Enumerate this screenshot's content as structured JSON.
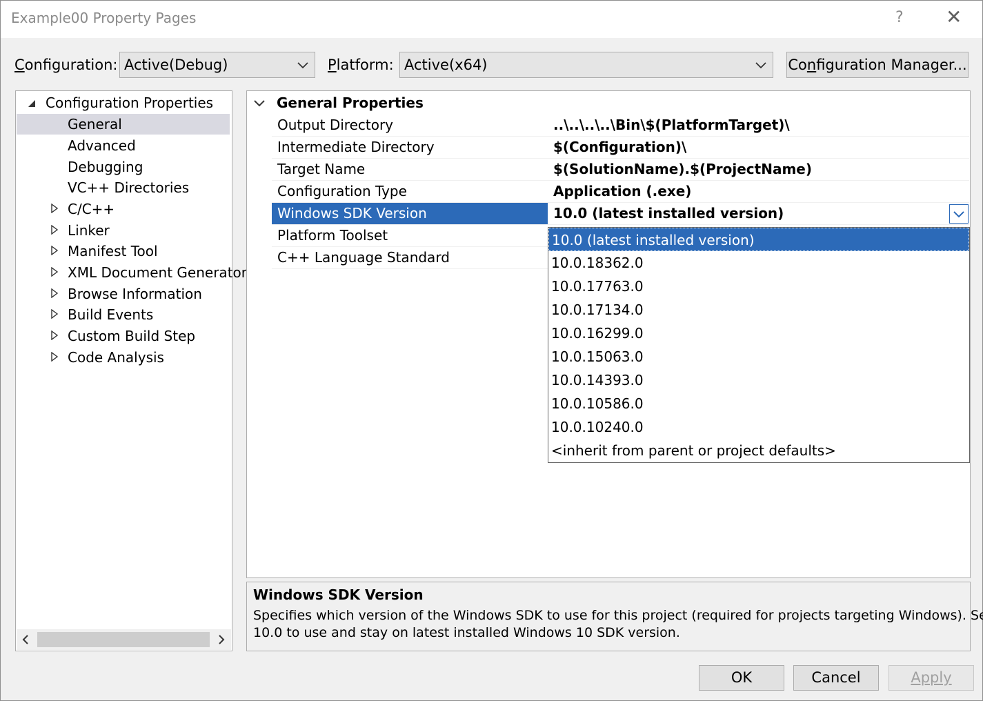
{
  "window": {
    "title": "Example00 Property Pages",
    "help": "?",
    "close": "✕"
  },
  "toolbar": {
    "configuration_label": "Configuration:",
    "configuration_label_key": "C",
    "configuration_label_rest": "onfiguration:",
    "configuration_value": "Active(Debug)",
    "platform_label_key": "P",
    "platform_label_rest": "latform:",
    "platform_value": "Active(x64)",
    "config_manager_pre": "Co",
    "config_manager_key": "n",
    "config_manager_rest": "figuration Manager..."
  },
  "tree": {
    "root": "Configuration Properties",
    "items": [
      {
        "label": "General",
        "expandable": false,
        "selected": true
      },
      {
        "label": "Advanced",
        "expandable": false
      },
      {
        "label": "Debugging",
        "expandable": false
      },
      {
        "label": "VC++ Directories",
        "expandable": false
      },
      {
        "label": "C/C++",
        "expandable": true
      },
      {
        "label": "Linker",
        "expandable": true
      },
      {
        "label": "Manifest Tool",
        "expandable": true
      },
      {
        "label": "XML Document Generator",
        "expandable": true
      },
      {
        "label": "Browse Information",
        "expandable": true
      },
      {
        "label": "Build Events",
        "expandable": true
      },
      {
        "label": "Custom Build Step",
        "expandable": true
      },
      {
        "label": "Code Analysis",
        "expandable": true
      }
    ]
  },
  "grid": {
    "section": "General Properties",
    "rows": [
      {
        "name": "Output Directory",
        "value": "..\\..\\..\\..\\Bin\\$(PlatformTarget)\\"
      },
      {
        "name": "Intermediate Directory",
        "value": "$(Configuration)\\"
      },
      {
        "name": "Target Name",
        "value": "$(SolutionName).$(ProjectName)"
      },
      {
        "name": "Configuration Type",
        "value": "Application (.exe)"
      },
      {
        "name": "Windows SDK Version",
        "value": "10.0 (latest installed version)",
        "selected": true
      },
      {
        "name": "Platform Toolset",
        "value": ""
      },
      {
        "name": "C++ Language Standard",
        "value": ""
      }
    ]
  },
  "dropdown": {
    "options": [
      "10.0 (latest installed version)",
      "10.0.18362.0",
      "10.0.17763.0",
      "10.0.17134.0",
      "10.0.16299.0",
      "10.0.15063.0",
      "10.0.14393.0",
      "10.0.10586.0",
      "10.0.10240.0",
      "<inherit from parent or project defaults>"
    ],
    "selected_index": 0
  },
  "description": {
    "title": "Windows SDK Version",
    "text_line1": "Specifies which version of the Windows SDK to use for this project (required for projects targeting Windows). Select",
    "text_line2": "10.0 to use and stay on latest installed Windows 10 SDK version."
  },
  "buttons": {
    "ok": "OK",
    "cancel": "Cancel",
    "apply": "Apply"
  },
  "colors": {
    "selection": "#2c6ab8",
    "tree_selection": "#d9d9e1",
    "disabled_text": "#a0a0a0"
  }
}
